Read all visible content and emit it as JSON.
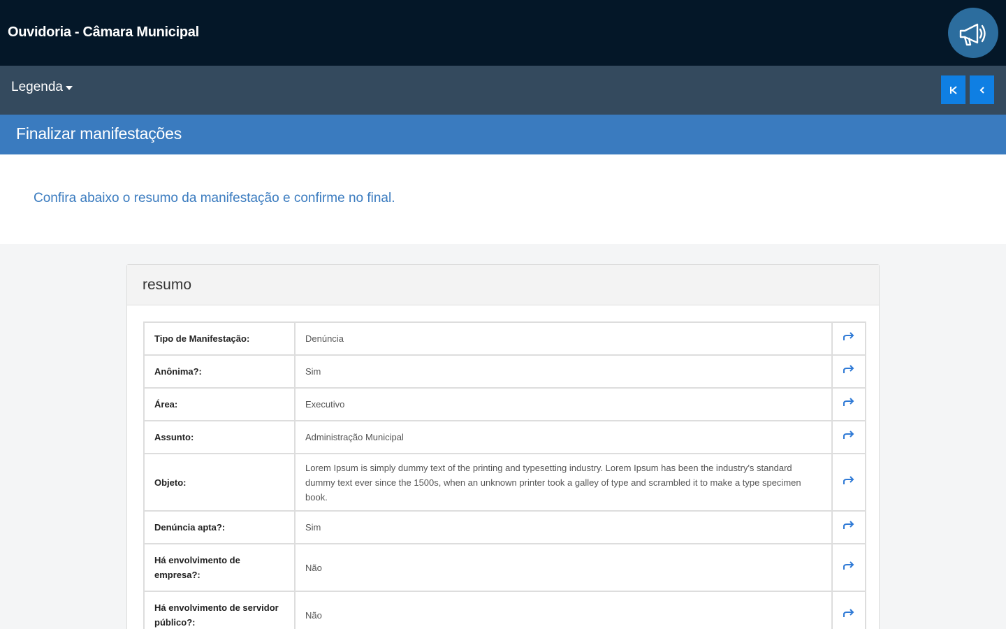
{
  "header": {
    "title": "Ouvidoria - Câmara Municipal",
    "megaphone_icon": "megaphone-icon"
  },
  "toolbar": {
    "legend_label": "Legenda",
    "first_icon": "skip-first-icon",
    "prev_icon": "chevron-left-icon"
  },
  "section": {
    "title": "Finalizar manifestações"
  },
  "intro": {
    "text": "Confira abaixo o resumo da manifestação e confirme no final."
  },
  "panel": {
    "title": "resumo",
    "rows": [
      {
        "label": "Tipo de Manifestação:",
        "value": "Denúncia"
      },
      {
        "label": "Anônima?:",
        "value": "Sim"
      },
      {
        "label": "Área:",
        "value": "Executivo"
      },
      {
        "label": "Assunto:",
        "value": "Administração Municipal"
      },
      {
        "label": "Objeto:",
        "value": "Lorem Ipsum is simply dummy text of the printing and typesetting industry. Lorem Ipsum has been the industry's standard dummy text ever since the 1500s, when an unknown printer took a galley of type and scrambled it to make a type specimen book."
      },
      {
        "label": "Denúncia apta?:",
        "value": "Sim"
      },
      {
        "label": "Há envolvimento de empresa?:",
        "value": "Não"
      },
      {
        "label": "Há envolvimento de servidor público?:",
        "value": "Não"
      }
    ]
  },
  "colors": {
    "topbar": "#041728",
    "subbar": "#344a5e",
    "section": "#3a7bbf",
    "button": "#0f7fe3",
    "link": "#3a7bbf"
  }
}
